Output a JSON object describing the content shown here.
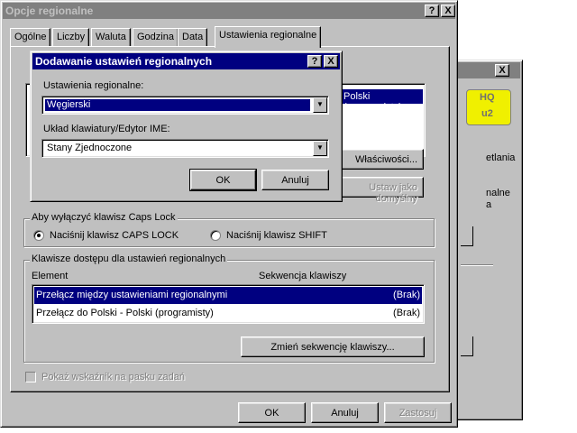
{
  "main_window": {
    "title": "Opcje regionalne",
    "help_btn": "?",
    "close_btn": "X",
    "tabs": [
      "Ogólne",
      "Liczby",
      "Waluta",
      "Godzina",
      "Data",
      "Ustawienia regionalne"
    ],
    "installed_list_item": "Polski (programisty)",
    "properties_button": "Właściwości...",
    "set_default_button": "Ustaw jako domyślny",
    "caps_lock_group": {
      "label": "Aby wyłączyć klawisz Caps Lock",
      "option_caps": "Naciśnij klawisz CAPS LOCK",
      "option_shift": "Naciśnij klawisz SHIFT",
      "selected": "caps"
    },
    "hotkeys_group": {
      "label": "Klawisze dostępu dla ustawień regionalnych",
      "col_element": "Element",
      "col_sequence": "Sekwencja klawiszy",
      "rows": [
        {
          "element": "Przełącz między ustawieniami regionalnymi",
          "sequence": "(Brak)"
        },
        {
          "element": "Przełącz do Polski - Polski (programisty)",
          "sequence": "(Brak)"
        }
      ],
      "change_button": "Zmień sekwencję klawiszy..."
    },
    "taskbar_indicator_label": "Pokaż wskaźnik na pasku zadań",
    "ok_button": "OK",
    "cancel_button": "Anuluj",
    "apply_button": "Zastosuj"
  },
  "add_dialog": {
    "title": "Dodawanie ustawień regionalnych",
    "help_btn": "?",
    "close_btn": "X",
    "locale_label": "Ustawienia regionalne:",
    "locale_value": "Węgierski",
    "keyboard_label": "Układ klawiatury/Edytor IME:",
    "keyboard_value": "Stany Zjednoczone",
    "ok_button": "OK",
    "cancel_button": "Anuluj"
  },
  "bg_window": {
    "close_btn": "X",
    "text1": "etlania",
    "text2a": "nalne",
    "text2b": "a"
  },
  "colors": {
    "face": "#c0c0c0",
    "active_title": "#000080",
    "inactive_title": "#808080",
    "selection": "#000080",
    "icon_yellow": "#f0f000"
  }
}
